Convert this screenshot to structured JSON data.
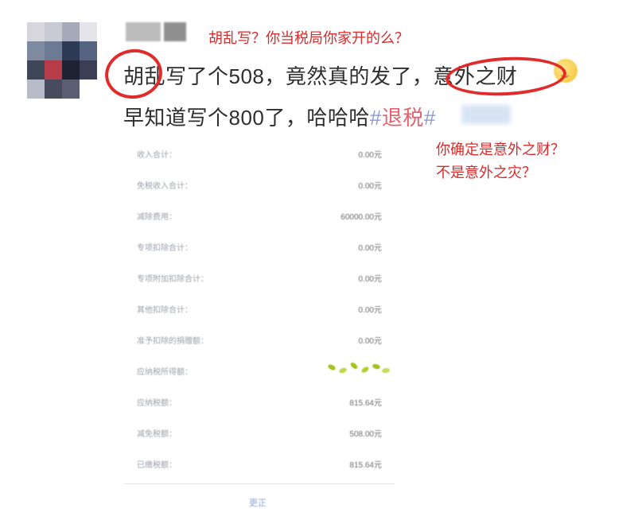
{
  "post": {
    "line1": "胡乱写了个508，竟然真的发了，意外之财",
    "line2_text": "早知道写个800了，哈哈哈",
    "hashtag_mark": "#",
    "hashtag_text": "退税",
    "hashtag_mark_end": "#"
  },
  "annotations": {
    "top": "胡乱写？你当税局你家开的么？",
    "right_line1": "你确定是意外之财？",
    "right_line2": "不是意外之灾？"
  },
  "tax_table": {
    "rows": [
      {
        "label": "收入合计：",
        "value": "0.00元"
      },
      {
        "label": "免税收入合计：",
        "value": "0.00元"
      },
      {
        "label": "减除费用：",
        "value": "60000.00元"
      },
      {
        "label": "专项扣除合计：",
        "value": "0.00元"
      },
      {
        "label": "专项附加扣除合计：",
        "value": "0.00元"
      },
      {
        "label": "其他扣除合计：",
        "value": "0.00元"
      },
      {
        "label": "准予扣除的捐赠额：",
        "value": "0.00元"
      },
      {
        "label": "应纳税所得额：",
        "value": ""
      },
      {
        "label": "应纳税额：",
        "value": "815.64元"
      },
      {
        "label": "减免税额：",
        "value": "508.00元"
      },
      {
        "label": "已缴税额：",
        "value": "815.64元"
      }
    ]
  },
  "bottom_link": "更正",
  "colors": {
    "annotation_red": "#e12a2a",
    "hashtag_pink": "#e4626e",
    "hashtag_blue": "#8a9bd1"
  }
}
